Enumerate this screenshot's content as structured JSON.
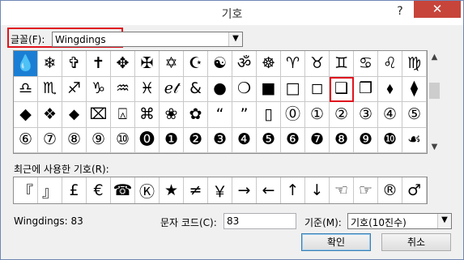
{
  "window": {
    "title": "기호",
    "help": "?",
    "close": "✕"
  },
  "font": {
    "label": "글꼴(F):",
    "value": "Wingdings"
  },
  "grid": {
    "rows": [
      [
        "💧",
        "❄",
        "✞",
        "✝",
        "✥",
        "✠",
        "✡",
        "☪",
        "☯",
        "ॐ",
        "☸",
        "♈",
        "♉",
        "♊",
        "♋",
        "♌",
        "♍"
      ],
      [
        "♎",
        "♏",
        "♐",
        "♑",
        "♒",
        "♓",
        "ℯ𝓉",
        "&",
        "●",
        "❍",
        "■",
        "□",
        "◻",
        "❑",
        "❒",
        "⬧",
        "⧫"
      ],
      [
        "◆",
        "❖",
        "⬥",
        "⌧",
        "⍓",
        "⌘",
        "❀",
        "✿",
        "“",
        "”",
        "▯",
        "⓪",
        "①",
        "②",
        "③",
        "④",
        "⑤"
      ],
      [
        "⑥",
        "⑦",
        "⑧",
        "⑨",
        "⑩",
        "⓿",
        "❶",
        "❷",
        "❸",
        "❹",
        "❺",
        "❻",
        "❼",
        "❽",
        "❾",
        "❿",
        "☙"
      ]
    ]
  },
  "recent": {
    "label": "최근에 사용한 기호(R):",
    "items": [
      "『",
      "』",
      "£",
      "€",
      "☎",
      "Ⓚ",
      "★",
      "≠",
      "￥",
      "→",
      "←",
      "↑",
      "↓",
      "☜",
      "☞",
      "®",
      "♂"
    ]
  },
  "status": {
    "char_name": "Wingdings: 83"
  },
  "charcode": {
    "label": "문자 코드(C):",
    "value": "83"
  },
  "base": {
    "label": "기준(M):",
    "value": "기호(10진수)"
  },
  "buttons": {
    "ok": "확인",
    "cancel": "취소"
  },
  "colors": {
    "selection": "#1a7fd4",
    "highlight": "#e0141e"
  }
}
